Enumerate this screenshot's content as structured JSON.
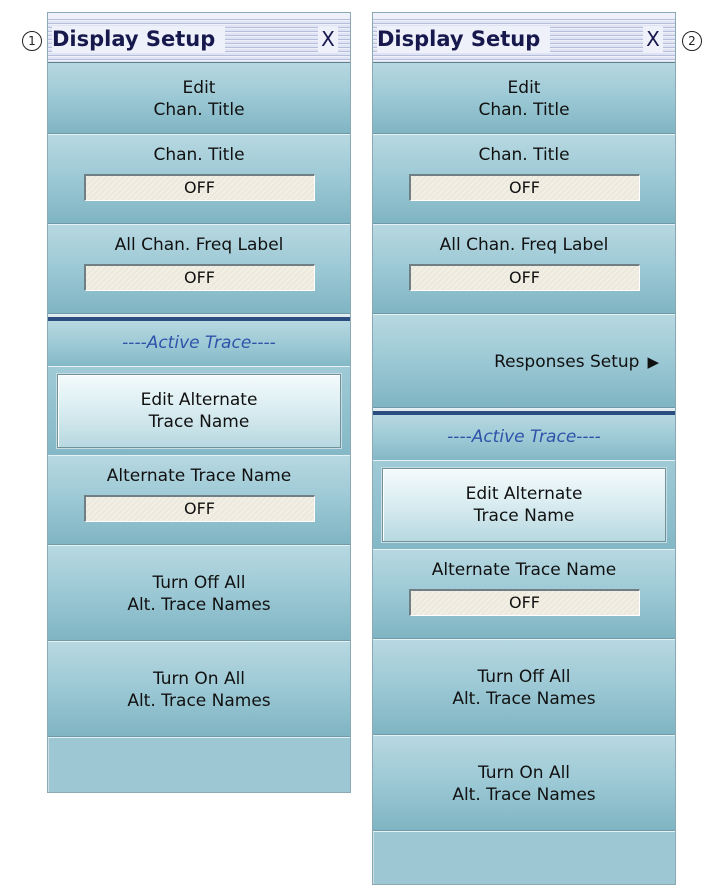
{
  "callouts": {
    "left": "1",
    "right": "2"
  },
  "panel1": {
    "title": "Display Setup",
    "close": "X",
    "edit_chan_title": {
      "line1": "Edit",
      "line2": "Chan. Title"
    },
    "chan_title": {
      "label": "Chan. Title",
      "value": "OFF"
    },
    "all_chan_freq": {
      "label": "All Chan. Freq Label",
      "value": "OFF"
    },
    "active_trace": "----Active Trace----",
    "edit_alt": {
      "line1": "Edit Alternate",
      "line2": "Trace Name"
    },
    "alt_trace_name": {
      "label": "Alternate Trace Name",
      "value": "OFF"
    },
    "turn_off_all": {
      "line1": "Turn Off All",
      "line2": "Alt. Trace Names"
    },
    "turn_on_all": {
      "line1": "Turn On All",
      "line2": "Alt. Trace Names"
    }
  },
  "panel2": {
    "title": "Display Setup",
    "close": "X",
    "edit_chan_title": {
      "line1": "Edit",
      "line2": "Chan. Title"
    },
    "chan_title": {
      "label": "Chan. Title",
      "value": "OFF"
    },
    "all_chan_freq": {
      "label": "All Chan. Freq Label",
      "value": "OFF"
    },
    "responses_setup": "Responses Setup",
    "active_trace": "----Active Trace----",
    "edit_alt": {
      "line1": "Edit Alternate",
      "line2": "Trace Name"
    },
    "alt_trace_name": {
      "label": "Alternate Trace Name",
      "value": "OFF"
    },
    "turn_off_all": {
      "line1": "Turn Off All",
      "line2": "Alt. Trace Names"
    },
    "turn_on_all": {
      "line1": "Turn On All",
      "line2": "Alt. Trace Names"
    }
  },
  "icons": {
    "submenu_arrow": "▶"
  }
}
